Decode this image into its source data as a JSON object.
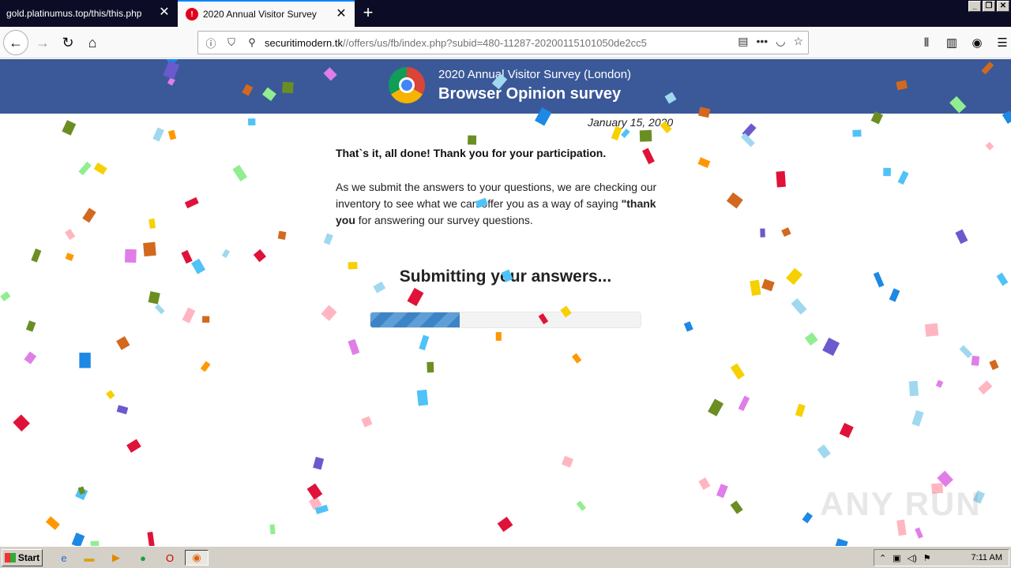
{
  "browser": {
    "tabs": [
      {
        "title": "gold.platinumus.top/this/this.php",
        "active": false
      },
      {
        "title": "2020 Annual Visitor Survey",
        "active": true,
        "badge": "!"
      }
    ],
    "url": {
      "host": "securitimodern.tk",
      "path": "//offers/us/fb/index.php?subid=480-11287-20200115101050de2cc5"
    }
  },
  "page": {
    "banner_subtitle": "2020 Annual Visitor Survey (London)",
    "banner_title": "Browser Opinion survey",
    "date": "January 15, 2020",
    "done_text": "That`s it, all done! Thank you for your participation.",
    "body_text_1": "As we submit the answers to your questions, we are checking our inventory to see what we can offer you as a way of saying ",
    "body_text_bold": "\"thank you",
    "body_text_2": " for answering our survey questions.",
    "submitting_text": "Submitting your answers...",
    "progress": 0.33,
    "watermark": "ANY RUN"
  },
  "taskbar": {
    "start_label": "Start",
    "clock": "7:11 AM"
  }
}
